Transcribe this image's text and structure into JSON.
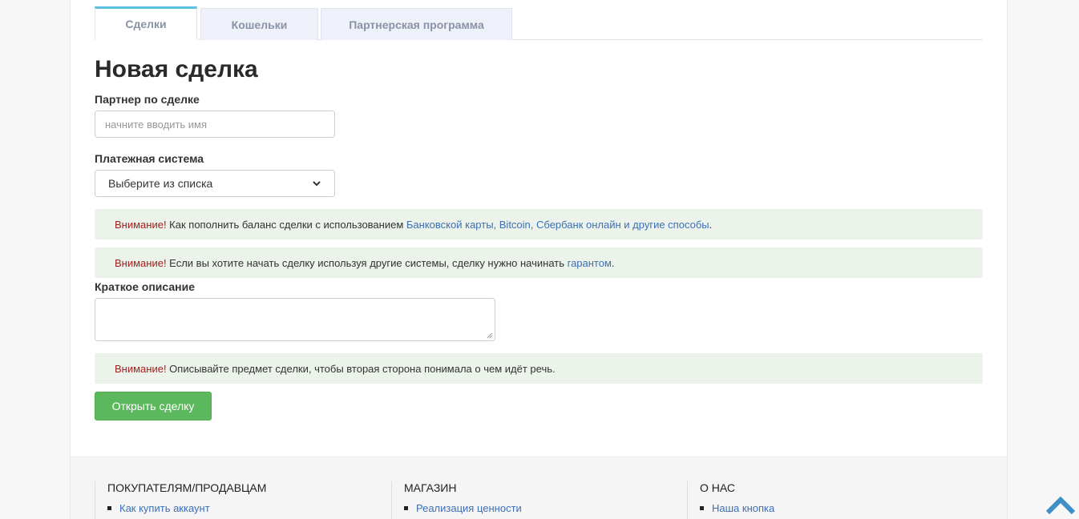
{
  "tabs": [
    {
      "label": "Сделки",
      "active": true
    },
    {
      "label": "Кошельки",
      "active": false
    },
    {
      "label": "Партнерская программа",
      "active": false
    }
  ],
  "page_title": "Новая сделка",
  "partner": {
    "label": "Партнер по сделке",
    "placeholder": "начните вводить имя"
  },
  "payment": {
    "label": "Платежная система",
    "selected": "Выберите из списка"
  },
  "alerts": [
    {
      "warn": "Внимание!",
      "text": " Как пополнить баланс сделки с использованием ",
      "link": "Банковской карты, Bitcoin, Сбербанк онлайн и другие способы",
      "tail": "."
    },
    {
      "warn": "Внимание!",
      "text": " Если вы хотите начать сделку используя другие системы, сделку нужно начинать ",
      "link": "гарантом",
      "tail": "."
    },
    {
      "warn": "Внимание!",
      "text": " Описывайте предмет сделки, чтобы вторая сторона понимала о чем идёт речь.",
      "link": "",
      "tail": ""
    }
  ],
  "description": {
    "label": "Краткое описание"
  },
  "submit_label": "Открыть сделку",
  "footer": {
    "cols": [
      {
        "title": "ПОКУПАТЕЛЯМ/ПРОДАВЦАМ",
        "links": [
          "Как купить аккаунт"
        ]
      },
      {
        "title": "МАГАЗИН",
        "links": [
          "Реализация ценности"
        ]
      },
      {
        "title": "О НАС",
        "links": [
          "Наша кнопка"
        ]
      }
    ]
  },
  "colors": {
    "accent_tab": "#5bc0de",
    "button": "#5cb85c",
    "alert_bg": "#ebf3ea",
    "warn": "#a51e1e",
    "link": "#3d6fb6"
  },
  "icons": {
    "select_arrow": "chevron-down-icon",
    "scroll_top": "chevron-up-icon"
  }
}
